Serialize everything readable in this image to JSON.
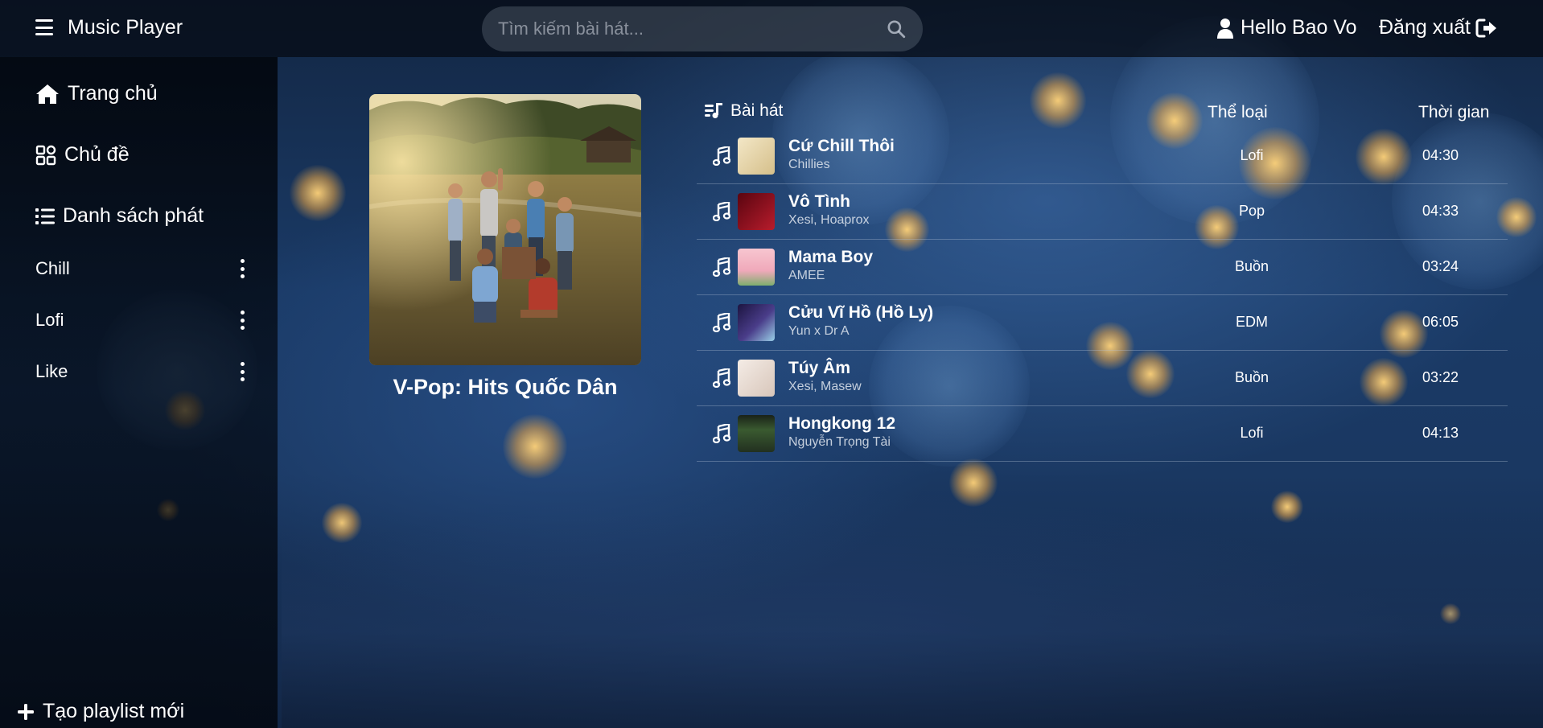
{
  "header": {
    "app_title": "Music Player",
    "search_placeholder": "Tìm kiếm bài hát...",
    "greeting": "Hello Bao Vo",
    "logout_label": "Đăng xuất"
  },
  "sidebar": {
    "nav": [
      {
        "label": "Trang chủ",
        "icon": "home-icon"
      },
      {
        "label": "Chủ đề",
        "icon": "topics-icon"
      },
      {
        "label": "Danh sách phát",
        "icon": "list-icon"
      }
    ],
    "playlists": [
      {
        "label": "Chill"
      },
      {
        "label": "Lofi"
      },
      {
        "label": "Like"
      }
    ],
    "new_playlist_label": "Tạo playlist mới"
  },
  "album": {
    "title": "V-Pop: Hits Quốc Dân"
  },
  "table": {
    "col_song": "Bài hát",
    "col_genre": "Thể loại",
    "col_time": "Thời gian",
    "songs": [
      {
        "title": "Cứ Chill Thôi",
        "artist": "Chillies",
        "genre": "Lofi",
        "duration": "04:30",
        "thumb_color": "#e8dcc0"
      },
      {
        "title": "Vô Tình",
        "artist": "Xesi, Hoaprox",
        "genre": "Pop",
        "duration": "04:33",
        "thumb_color": "#8a1020"
      },
      {
        "title": "Mama Boy",
        "artist": "AMEE",
        "genre": "Buồn",
        "duration": "03:24",
        "thumb_color": "#f0b7c4"
      },
      {
        "title": "Cửu Vĩ Hồ (Hồ Ly)",
        "artist": "Yun x Dr A",
        "genre": "EDM",
        "duration": "06:05",
        "thumb_color": "#2a1f55"
      },
      {
        "title": "Túy Âm",
        "artist": "Xesi, Masew",
        "genre": "Buồn",
        "duration": "03:22",
        "thumb_color": "#efe4dc"
      },
      {
        "title": "Hongkong 12",
        "artist": "Nguyễn Trọng Tài",
        "genre": "Lofi",
        "duration": "04:13",
        "thumb_color": "#2c3a2a"
      }
    ]
  },
  "colors": {
    "header_bg": "#05080f",
    "sidebar_bg": "#03080f",
    "accent_gold": "#f4b860",
    "page_bg": "#1a3862"
  }
}
